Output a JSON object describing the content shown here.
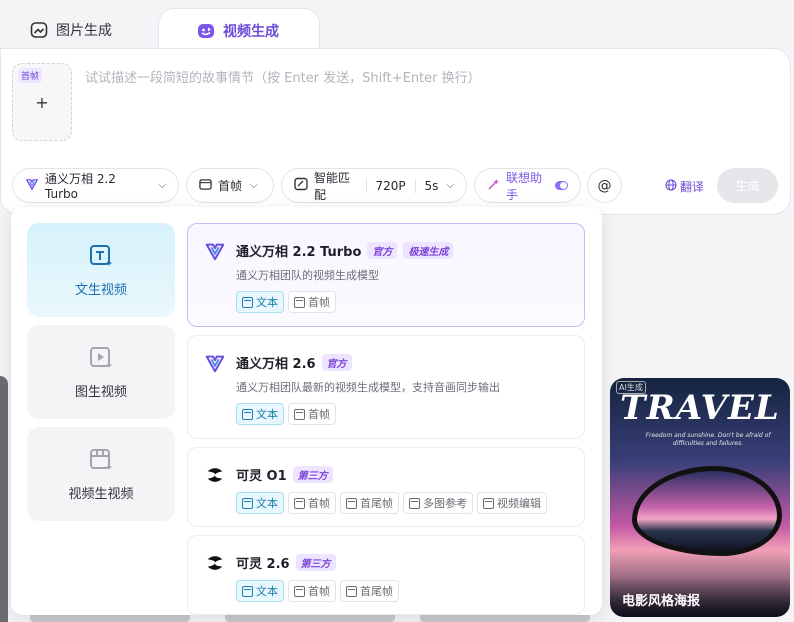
{
  "tabs": [
    {
      "label": "图片生成",
      "icon": "image-gen-icon",
      "active": false
    },
    {
      "label": "视频生成",
      "icon": "video-gen-icon",
      "active": true
    }
  ],
  "composer": {
    "first_frame_badge": "首帧",
    "add_symbol": "+",
    "prompt_placeholder": "试试描述一段简短的故事情节（按 Enter 发送，Shift+Enter 换行）",
    "model_selector": "通义万相 2.2 Turbo",
    "frame_mode": "首帧",
    "smart_match": "智能匹配",
    "resolution": "720P",
    "duration": "5s",
    "assistant_label": "联想助手",
    "assistant_enabled": true,
    "mention_symbol": "@",
    "translate_label": "翻译",
    "generate_label": "生成"
  },
  "categories": [
    {
      "label": "文生视频",
      "icon": "text-to-video-icon",
      "active": true
    },
    {
      "label": "图生视频",
      "icon": "image-to-video-icon",
      "active": false
    },
    {
      "label": "视频生视频",
      "icon": "video-to-video-icon",
      "active": false
    }
  ],
  "models": [
    {
      "name": "通义万相 2.2 Turbo",
      "badges": [
        "官方",
        "极速生成"
      ],
      "description": "通义万相团队的视频生成模型",
      "capabilities": [
        "文本",
        "首帧"
      ],
      "selected": true,
      "logo": "wanxiang-logo-icon"
    },
    {
      "name": "通义万相 2.6",
      "badges": [
        "官方"
      ],
      "description": "通义万相团队最新的视频生成模型，支持音画同步输出",
      "capabilities": [
        "文本",
        "首帧"
      ],
      "selected": false,
      "logo": "wanxiang-logo-icon"
    },
    {
      "name": "可灵 O1",
      "badges": [
        "第三方"
      ],
      "description": "",
      "capabilities": [
        "文本",
        "首帧",
        "首尾帧",
        "多图参考",
        "视频编辑"
      ],
      "selected": false,
      "logo": "kling-logo-icon"
    },
    {
      "name": "可灵 2.6",
      "badges": [
        "第三方"
      ],
      "description": "",
      "capabilities": [
        "文本",
        "首帧",
        "首尾帧"
      ],
      "selected": false,
      "logo": "kling-logo-icon"
    }
  ],
  "gallery": {
    "poster_ai_tag": "AI生成",
    "poster_title": "TRAVEL",
    "poster_tagline": "Freedom and sunshine. Don't be afraid of difficulties and failures.",
    "poster_label": "电影风格海报"
  },
  "colors": {
    "accent": "#6b4bd8",
    "category_active": "#1f6fb0",
    "badge_bg": "#ede4ff"
  }
}
